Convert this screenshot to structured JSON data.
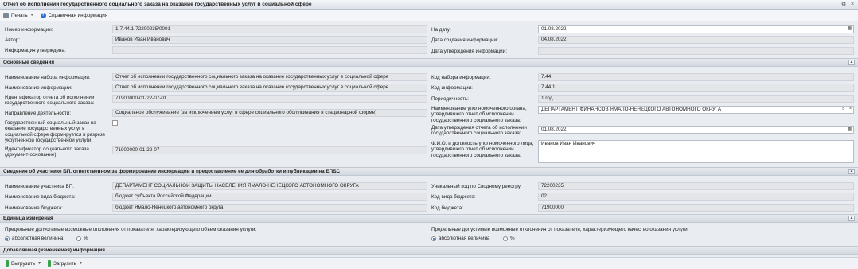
{
  "window": {
    "title": "Отчет об исполнении государственного социального заказа на оказание государственных услуг в социальной сфере"
  },
  "toolbar": {
    "print": "Печать",
    "help": "Справочная информация"
  },
  "header": {
    "info_number_label": "Номер информации:",
    "info_number": "1-7.44.1-72200235/0001",
    "date_label": "На дату:",
    "date": "01.08.2022",
    "author_label": "Автор:",
    "author": "Иванов Иван Иванович",
    "created_label": "Дата создания информации:",
    "created": "04.08.2022",
    "approved_label": "Информация утверждена:",
    "approved": "",
    "approved_date_label": "Дата утверждения информации:",
    "approved_date": ""
  },
  "main": {
    "section": "Основные сведения",
    "set_name_label": "Наименование набора информации:",
    "set_name": "Отчет об исполнении государственного социального заказа на оказание государственных услуг в социальной сфере",
    "set_code_label": "Код набора информации:",
    "set_code": "7.44",
    "info_name_label": "Наименование информации:",
    "info_name": "Отчет об исполнении государственного социального заказа на оказание государственных услуг в социальной сфере",
    "info_code_label": "Код информации:",
    "info_code": "7.44.1",
    "report_id_label": "Идентификатор отчета об исполнении государственного социального заказа:",
    "report_id": "71900000-01-22-07-01",
    "periodicity_label": "Периодичность:",
    "periodicity": "1 год",
    "direction_label": "Направление деятельности:",
    "direction": "Социальное обслуживание (за исключением услуг в сфере социального обслуживания в стационарной форме)",
    "authority_label": "Наименование уполномоченного органа, утвердившего отчет об исполнении государственного социального заказа:",
    "authority": "ДЕПАРТАМЕНТ ФИНАНСОВ ЯМАЛО-НЕНЕЦКОГО АВТОНОМНОГО ОКРУГА",
    "enlarged_label": "Государственный социальный заказ на оказание государственных услуг в социальной сфере формируется в разрезе укрупненной государственной услуги:",
    "report_date_label": "Дата утверждения отчета об исполнении государственного социального заказа:",
    "report_date": "01.08.2022",
    "order_id_label": "Идентификатор социального заказа (документ-основание):",
    "order_id": "71900000-01-22-07",
    "official_label": "Ф.И.О. и должность уполномоченного лица, утвердившего отчет об исполнении государственного социального заказа:",
    "official": "Иванов Иван Иванович"
  },
  "participant": {
    "section": "Сведения об участнике БП, ответственном за формирование информации и предоставление ее для обработки и публикации на ЕПБС",
    "name_label": "Наименование участника БП:",
    "name": "ДЕПАРТАМЕНТ СОЦИАЛЬНОЙ ЗАЩИТЫ НАСЕЛЕНИЯ ЯМАЛО-НЕНЕЦКОГО АВТОНОМНОГО ОКРУГА",
    "code_label": "Уникальный код по Сводному реестру:",
    "code": "72200235",
    "budget_type_label": "Наименование вида бюджета:",
    "budget_type": "бюджет субъекта Российской Федерации",
    "budget_type_code_label": "Код вида бюджета:",
    "budget_type_code": "02",
    "budget_label": "Наименование бюджета:",
    "budget": "бюджет Ямало-Ненецкого автономного округа",
    "budget_code_label": "Код бюджета:",
    "budget_code": "71900000"
  },
  "units": {
    "section": "Единица измерения",
    "volume_label": "Предельные допустимые возможные отклонения от показателя, характеризующего объем оказания услуги:",
    "quality_label": "Предельные допустимые возможные отклонения от показателя, характеризующего качество оказания услуги:",
    "absolute": "абсолютная величина",
    "percent": "%"
  },
  "added": {
    "section": "Добавляемая (изменяемая) информация"
  },
  "bottom": {
    "export": "Выгрузить",
    "import": "Загрузить"
  }
}
